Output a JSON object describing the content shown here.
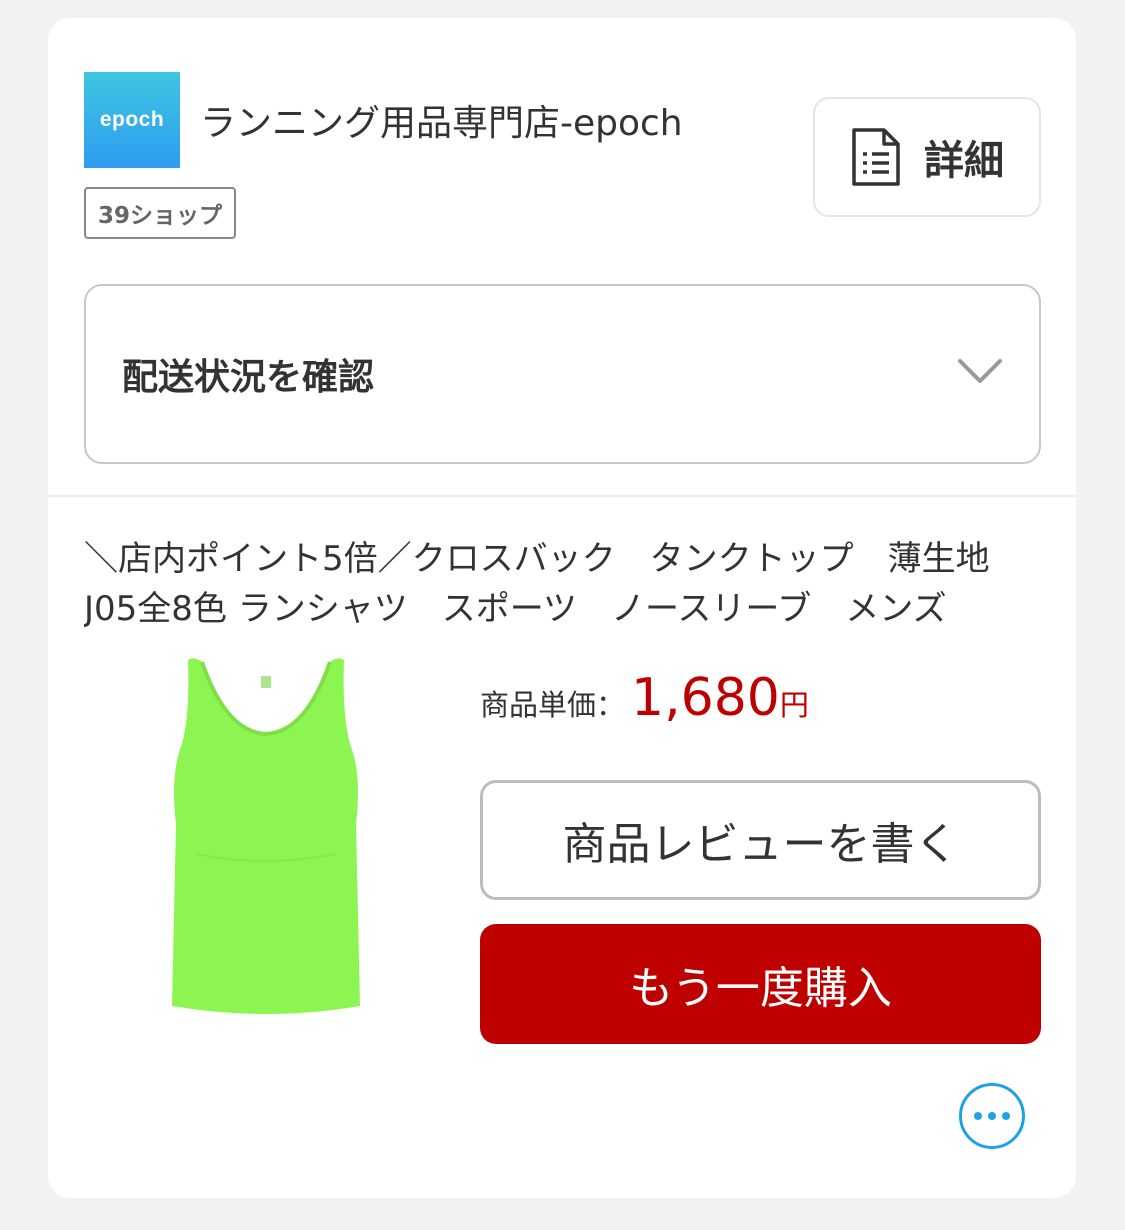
{
  "shop": {
    "logo_text": "epoch",
    "name": "ランニング用品専門店-epoch",
    "badge": "39ショップ",
    "detail_label": "詳細"
  },
  "delivery": {
    "label": "配送状況を確認"
  },
  "product": {
    "title": "＼店内ポイント5倍／クロスバック　タンクトップ　薄生地　J05全8色 ランシャツ　スポーツ　ノースリーブ　メンズ",
    "image_color": "#8df552",
    "price_label": "商品単価：",
    "price_value": "1,680",
    "price_unit": "円"
  },
  "actions": {
    "review_label": "商品レビューを書く",
    "rebuy_label": "もう一度購入"
  },
  "colors": {
    "accent_red": "#bf0000",
    "more_blue": "#1ea1e8"
  },
  "icons": [
    "document-icon",
    "chevron-down-icon",
    "more-icon"
  ]
}
